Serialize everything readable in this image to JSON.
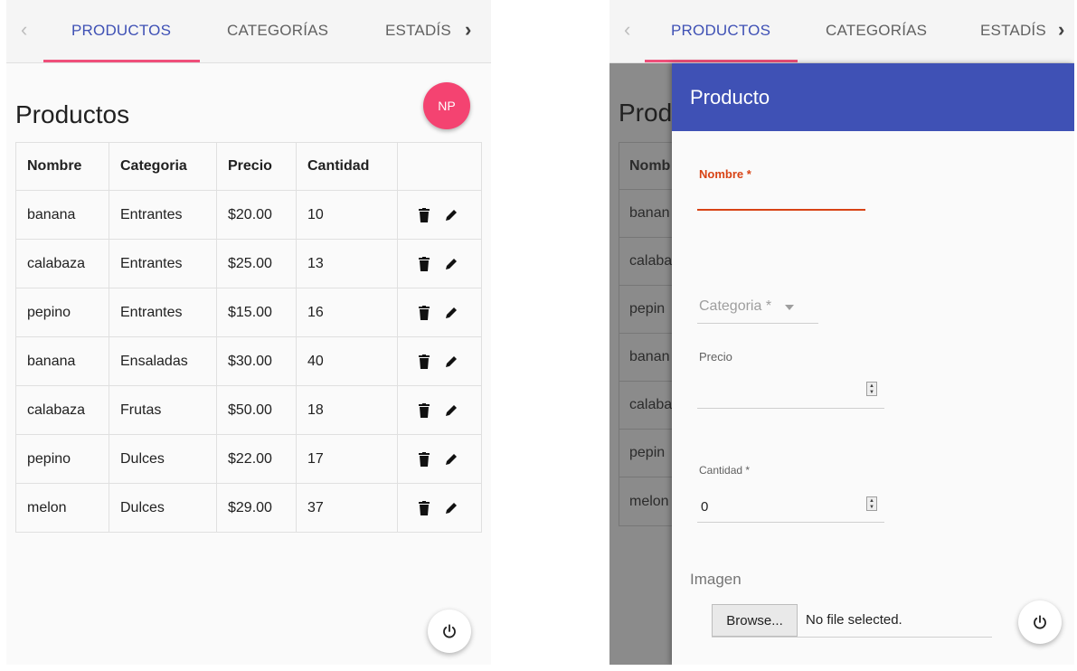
{
  "left": {
    "tabs": [
      {
        "label": "PRODUCTOS",
        "active": true
      },
      {
        "label": "CATEGORÍAS",
        "active": false
      },
      {
        "label": "ESTADÍS",
        "active": false
      }
    ],
    "prev_icon": "chevron-left-icon",
    "next_icon": "chevron-right-icon",
    "title": "Productos",
    "fab_label": "NP",
    "table": {
      "headers": [
        "Nombre",
        "Categoria",
        "Precio",
        "Cantidad",
        ""
      ],
      "rows": [
        {
          "nombre": "banana",
          "categoria": "Entrantes",
          "precio": "$20.00",
          "cantidad": "10"
        },
        {
          "nombre": "calabaza",
          "categoria": "Entrantes",
          "precio": "$25.00",
          "cantidad": "13"
        },
        {
          "nombre": "pepino",
          "categoria": "Entrantes",
          "precio": "$15.00",
          "cantidad": "16"
        },
        {
          "nombre": "banana",
          "categoria": "Ensaladas",
          "precio": "$30.00",
          "cantidad": "40"
        },
        {
          "nombre": "calabaza",
          "categoria": "Frutas",
          "precio": "$50.00",
          "cantidad": "18"
        },
        {
          "nombre": "pepino",
          "categoria": "Dulces",
          "precio": "$22.00",
          "cantidad": "17"
        },
        {
          "nombre": "melon",
          "categoria": "Dulces",
          "precio": "$29.00",
          "cantidad": "37"
        }
      ],
      "row_icons": [
        "delete-icon",
        "edit-icon"
      ]
    },
    "power_icon": "power-icon"
  },
  "right": {
    "tabs": [
      {
        "label": "PRODUCTOS",
        "active": true
      },
      {
        "label": "CATEGORÍAS",
        "active": false
      },
      {
        "label": "ESTADÍS",
        "active": false
      }
    ],
    "background_title": "Prod",
    "background_table": {
      "header": "Nomb",
      "rows": [
        "banan",
        "calaba",
        "pepin",
        "banan",
        "calaba",
        "pepin",
        "melon"
      ]
    },
    "dialog": {
      "title": "Producto",
      "nombre_label": "Nombre *",
      "nombre_value": "",
      "categoria_placeholder": "Categoria *",
      "precio_label": "Precio",
      "precio_value": "",
      "cantidad_label": "Cantidad *",
      "cantidad_value": "0",
      "imagen_label": "Imagen",
      "browse_label": "Browse...",
      "file_status": "No file selected."
    },
    "power_icon": "power-icon"
  },
  "colors": {
    "primary": "#3f51b5",
    "accent": "#f44371",
    "error": "#d84315",
    "tab_ink": "#ef4f7a"
  }
}
